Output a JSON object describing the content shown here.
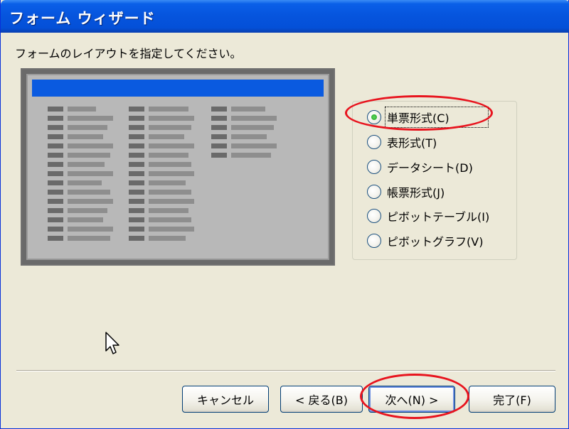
{
  "window": {
    "title": "フォーム ウィザード"
  },
  "instruction": "フォームのレイアウトを指定してください。",
  "layout_options": [
    {
      "label": "単票形式(C)",
      "checked": true
    },
    {
      "label": "表形式(T)",
      "checked": false
    },
    {
      "label": "データシート(D)",
      "checked": false
    },
    {
      "label": "帳票形式(J)",
      "checked": false
    },
    {
      "label": "ピボットテーブル(I)",
      "checked": false
    },
    {
      "label": "ピボットグラフ(V)",
      "checked": false
    }
  ],
  "buttons": {
    "cancel": "キャンセル",
    "back": "< 戻る(B)",
    "next": "次へ(N) >",
    "finish": "完了(F)"
  },
  "colors": {
    "titlebar": "#0654dd",
    "window_bg": "#ece9d8",
    "annotation": "#e8141e",
    "preview_header": "#0a5ae0"
  },
  "icons": {
    "cursor": "mouse-pointer-icon"
  }
}
